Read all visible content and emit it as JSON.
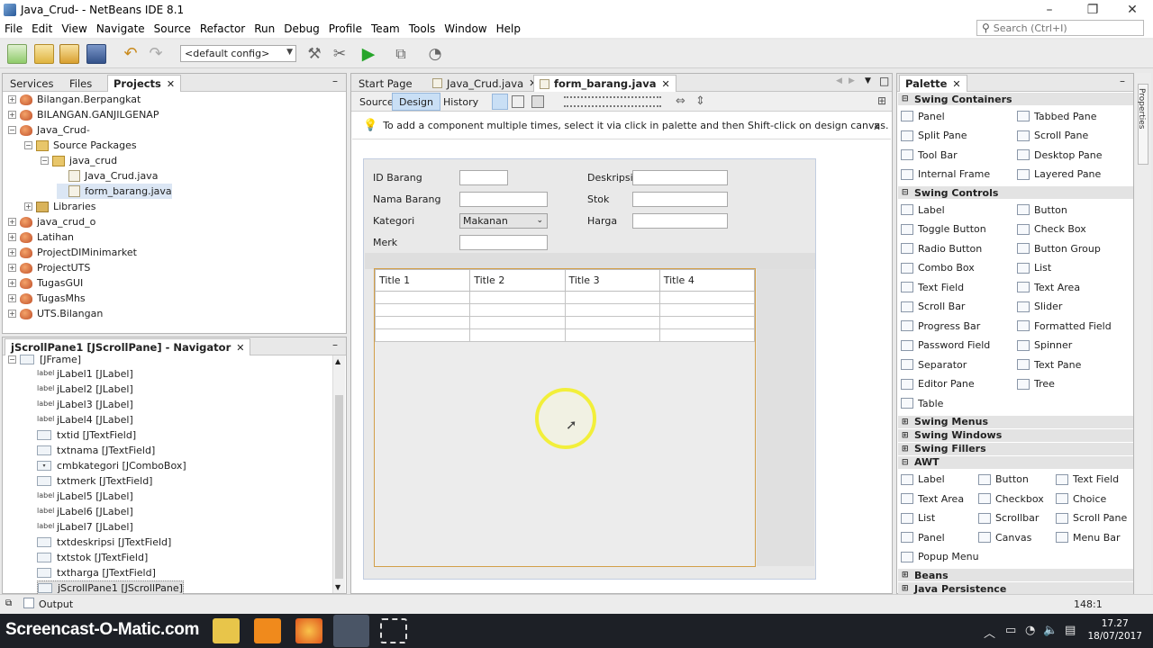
{
  "window": {
    "title": "Java_Crud- - NetBeans IDE 8.1",
    "controls": [
      "–",
      "❐",
      "✕"
    ]
  },
  "menu": [
    "File",
    "Edit",
    "View",
    "Navigate",
    "Source",
    "Refactor",
    "Run",
    "Debug",
    "Profile",
    "Team",
    "Tools",
    "Window",
    "Help"
  ],
  "search": {
    "placeholder": "Search (Ctrl+I)"
  },
  "toolbar": {
    "config": "<default config>"
  },
  "projects_panel": {
    "tabs": [
      "Services",
      "Files",
      "Projects"
    ],
    "active_tab": "Projects",
    "tree": [
      {
        "label": "Bilangan.Berpangkat",
        "level": 0,
        "type": "project",
        "expander": "+"
      },
      {
        "label": "BILANGAN.GANJILGENAP",
        "level": 0,
        "type": "project",
        "expander": "+"
      },
      {
        "label": "Java_Crud-",
        "level": 0,
        "type": "project",
        "expander": "−"
      },
      {
        "label": "Source Packages",
        "level": 1,
        "type": "package-root",
        "expander": "−"
      },
      {
        "label": "java_crud",
        "level": 2,
        "type": "package",
        "expander": "−"
      },
      {
        "label": "Java_Crud.java",
        "level": 3,
        "type": "file",
        "expander": ""
      },
      {
        "label": "form_barang.java",
        "level": 3,
        "type": "file",
        "expander": "",
        "selected": true
      },
      {
        "label": "Libraries",
        "level": 1,
        "type": "library",
        "expander": "+"
      },
      {
        "label": "java_crud_o",
        "level": 0,
        "type": "project",
        "expander": "+"
      },
      {
        "label": "Latihan",
        "level": 0,
        "type": "project",
        "expander": "+"
      },
      {
        "label": "ProjectDIMinimarket",
        "level": 0,
        "type": "project",
        "expander": "+"
      },
      {
        "label": "ProjectUTS",
        "level": 0,
        "type": "project",
        "expander": "+"
      },
      {
        "label": "TugasGUI",
        "level": 0,
        "type": "project",
        "expander": "+"
      },
      {
        "label": "TugasMhs",
        "level": 0,
        "type": "project",
        "expander": "+"
      },
      {
        "label": "UTS.Bilangan",
        "level": 0,
        "type": "project",
        "expander": "+"
      }
    ]
  },
  "navigator": {
    "title": "jScrollPane1 [JScrollPane] - Navigator",
    "root": "[JFrame]",
    "items": [
      {
        "label": "jLabel1 [JLabel]",
        "icon": "label"
      },
      {
        "label": "jLabel2 [JLabel]",
        "icon": "label"
      },
      {
        "label": "jLabel3 [JLabel]",
        "icon": "label"
      },
      {
        "label": "jLabel4 [JLabel]",
        "icon": "label"
      },
      {
        "label": "txtid [JTextField]",
        "icon": "field"
      },
      {
        "label": "txtnama [JTextField]",
        "icon": "field"
      },
      {
        "label": "cmbkategori [JComboBox]",
        "icon": "combo"
      },
      {
        "label": "txtmerk [JTextField]",
        "icon": "field"
      },
      {
        "label": "jLabel5 [JLabel]",
        "icon": "label"
      },
      {
        "label": "jLabel6 [JLabel]",
        "icon": "label"
      },
      {
        "label": "jLabel7 [JLabel]",
        "icon": "label"
      },
      {
        "label": "txtdeskripsi [JTextField]",
        "icon": "field"
      },
      {
        "label": "txtstok [JTextField]",
        "icon": "field"
      },
      {
        "label": "txtharga [JTextField]",
        "icon": "field"
      },
      {
        "label": "jScrollPane1 [JScrollPane]",
        "icon": "field",
        "selected": true
      }
    ]
  },
  "editor": {
    "tabs": [
      "Start Page",
      "Java_Crud.java",
      "form_barang.java"
    ],
    "active_tab": "form_barang.java",
    "view_tabs": [
      "Source",
      "Design",
      "History"
    ],
    "active_view": "Design",
    "hint": "To add a component multiple times, select it via click in palette and then Shift-click on design canvas.",
    "form": {
      "labels": {
        "id": "ID Barang",
        "nama": "Nama Barang",
        "kategori": "Kategori",
        "merk": "Merk",
        "deskripsi": "Deskripsi",
        "stok": "Stok",
        "harga": "Harga"
      },
      "combo_value": "Makanan",
      "table_headers": [
        "Title 1",
        "Title 2",
        "Title 3",
        "Title 4"
      ],
      "table_rows": 4
    }
  },
  "palette": {
    "title": "Palette",
    "categories": [
      {
        "name": "Swing Containers",
        "expanded": true,
        "items": [
          "Panel",
          "Tabbed Pane",
          "Split Pane",
          "Scroll Pane",
          "Tool Bar",
          "Desktop Pane",
          "Internal Frame",
          "Layered Pane"
        ]
      },
      {
        "name": "Swing Controls",
        "expanded": true,
        "items": [
          "Label",
          "Button",
          "Toggle Button",
          "Check Box",
          "Radio Button",
          "Button Group",
          "Combo Box",
          "List",
          "Text Field",
          "Text Area",
          "Scroll Bar",
          "Slider",
          "Progress Bar",
          "Formatted Field",
          "Password Field",
          "Spinner",
          "Separator",
          "Text Pane",
          "Editor Pane",
          "Tree",
          "Table"
        ]
      },
      {
        "name": "Swing Menus",
        "expanded": false,
        "items": []
      },
      {
        "name": "Swing Windows",
        "expanded": false,
        "items": []
      },
      {
        "name": "Swing Fillers",
        "expanded": false,
        "items": []
      },
      {
        "name": "AWT",
        "expanded": true,
        "items": [
          "Label",
          "Button",
          "Text Field",
          "Text Area",
          "Checkbox",
          "Choice",
          "List",
          "Scrollbar",
          "Scroll Pane",
          "Panel",
          "Canvas",
          "Menu Bar",
          "Popup Menu"
        ]
      },
      {
        "name": "Beans",
        "expanded": false,
        "items": []
      },
      {
        "name": "Java Persistence",
        "expanded": false,
        "items": []
      }
    ],
    "side_tab": "Properties"
  },
  "statusbar": {
    "output": "Output",
    "position": "148:1"
  },
  "taskbar": {
    "watermark": "Screencast-O-Matic.com",
    "time": "17.27",
    "date": "18/07/2017"
  },
  "colors": {
    "selection": "#c9dff5",
    "table_border": "#d39f48",
    "cursor_ring": "#f4f000"
  }
}
